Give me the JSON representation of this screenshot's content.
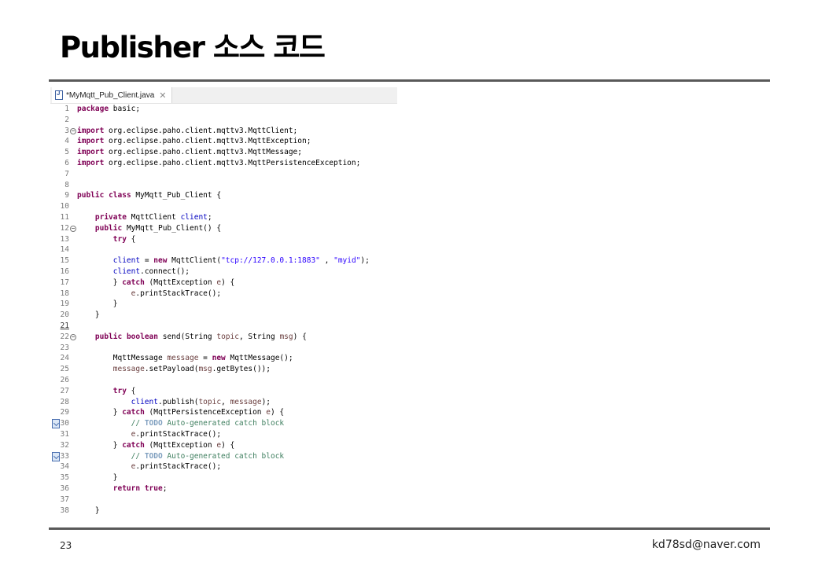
{
  "slide": {
    "title": "Publisher 소스 코드",
    "page_number": "23",
    "email": "kd78sd@naver.com"
  },
  "editor": {
    "tab": {
      "label": "*MyMqtt_Pub_Client.java",
      "icon": "java-file-icon",
      "close_glyph": "✕"
    },
    "lines": [
      {
        "num": "1",
        "tokens": [
          [
            "kw",
            "package"
          ],
          [
            "t",
            " basic;"
          ]
        ]
      },
      {
        "num": "2",
        "tokens": []
      },
      {
        "num": "3",
        "fold": true,
        "tokens": [
          [
            "kw",
            "import"
          ],
          [
            "t",
            " org.eclipse.paho.client.mqttv3.MqttClient;"
          ]
        ]
      },
      {
        "num": "4",
        "tokens": [
          [
            "kw",
            "import"
          ],
          [
            "t",
            " org.eclipse.paho.client.mqttv3.MqttException;"
          ]
        ]
      },
      {
        "num": "5",
        "tokens": [
          [
            "kw",
            "import"
          ],
          [
            "t",
            " org.eclipse.paho.client.mqttv3.MqttMessage;"
          ]
        ]
      },
      {
        "num": "6",
        "tokens": [
          [
            "kw",
            "import"
          ],
          [
            "t",
            " org.eclipse.paho.client.mqttv3.MqttPersistenceException;"
          ]
        ]
      },
      {
        "num": "7",
        "tokens": []
      },
      {
        "num": "8",
        "tokens": []
      },
      {
        "num": "9",
        "tokens": [
          [
            "kw",
            "public"
          ],
          [
            "t",
            " "
          ],
          [
            "kw",
            "class"
          ],
          [
            "t",
            " MyMqtt_Pub_Client {"
          ]
        ]
      },
      {
        "num": "10",
        "tokens": []
      },
      {
        "num": "11",
        "tokens": [
          [
            "t",
            "    "
          ],
          [
            "kw",
            "private"
          ],
          [
            "t",
            " MqttClient "
          ],
          [
            "fld",
            "client"
          ],
          [
            "t",
            ";"
          ]
        ]
      },
      {
        "num": "12",
        "fold": true,
        "tokens": [
          [
            "t",
            "    "
          ],
          [
            "kw",
            "public"
          ],
          [
            "t",
            " MyMqtt_Pub_Client() {"
          ]
        ]
      },
      {
        "num": "13",
        "tokens": [
          [
            "t",
            "        "
          ],
          [
            "kw",
            "try"
          ],
          [
            "t",
            " {"
          ]
        ]
      },
      {
        "num": "14",
        "tokens": []
      },
      {
        "num": "15",
        "tokens": [
          [
            "t",
            "        "
          ],
          [
            "fld",
            "client"
          ],
          [
            "t",
            " = "
          ],
          [
            "kw",
            "new"
          ],
          [
            "t",
            " MqttClient("
          ],
          [
            "str",
            "\"tcp://127.0.0.1:1883\""
          ],
          [
            "t",
            " , "
          ],
          [
            "str",
            "\"myid\""
          ],
          [
            "t",
            ");"
          ]
        ]
      },
      {
        "num": "16",
        "tokens": [
          [
            "t",
            "        "
          ],
          [
            "fld",
            "client"
          ],
          [
            "t",
            ".connect();"
          ]
        ]
      },
      {
        "num": "17",
        "tokens": [
          [
            "t",
            "        } "
          ],
          [
            "kw",
            "catch"
          ],
          [
            "t",
            " (MqttException "
          ],
          [
            "par",
            "e"
          ],
          [
            "t",
            ") {"
          ]
        ]
      },
      {
        "num": "18",
        "tokens": [
          [
            "t",
            "            "
          ],
          [
            "par",
            "e"
          ],
          [
            "t",
            ".printStackTrace();"
          ]
        ]
      },
      {
        "num": "19",
        "tokens": [
          [
            "t",
            "        }"
          ]
        ]
      },
      {
        "num": "20",
        "tokens": [
          [
            "t",
            "    }"
          ]
        ]
      },
      {
        "num": "21",
        "current": true,
        "tokens": []
      },
      {
        "num": "22",
        "fold": true,
        "tokens": [
          [
            "t",
            "    "
          ],
          [
            "kw",
            "public"
          ],
          [
            "t",
            " "
          ],
          [
            "kw",
            "boolean"
          ],
          [
            "t",
            " send(String "
          ],
          [
            "par",
            "topic"
          ],
          [
            "t",
            ", String "
          ],
          [
            "par",
            "msg"
          ],
          [
            "t",
            ") {"
          ]
        ]
      },
      {
        "num": "23",
        "tokens": []
      },
      {
        "num": "24",
        "tokens": [
          [
            "t",
            "        MqttMessage "
          ],
          [
            "par",
            "message"
          ],
          [
            "t",
            " = "
          ],
          [
            "kw",
            "new"
          ],
          [
            "t",
            " MqttMessage();"
          ]
        ]
      },
      {
        "num": "25",
        "tokens": [
          [
            "t",
            "        "
          ],
          [
            "par",
            "message"
          ],
          [
            "t",
            ".setPayload("
          ],
          [
            "par",
            "msg"
          ],
          [
            "t",
            ".getBytes());"
          ]
        ]
      },
      {
        "num": "26",
        "tokens": []
      },
      {
        "num": "27",
        "tokens": [
          [
            "t",
            "        "
          ],
          [
            "kw",
            "try"
          ],
          [
            "t",
            " {"
          ]
        ]
      },
      {
        "num": "28",
        "tokens": [
          [
            "t",
            "            "
          ],
          [
            "fld",
            "client"
          ],
          [
            "t",
            ".publish("
          ],
          [
            "par",
            "topic"
          ],
          [
            "t",
            ", "
          ],
          [
            "par",
            "message"
          ],
          [
            "t",
            ");"
          ]
        ]
      },
      {
        "num": "29",
        "tokens": [
          [
            "t",
            "        } "
          ],
          [
            "kw",
            "catch"
          ],
          [
            "t",
            " (MqttPersistenceException "
          ],
          [
            "par",
            "e"
          ],
          [
            "t",
            ") {"
          ]
        ]
      },
      {
        "num": "30",
        "marker": true,
        "tokens": [
          [
            "t",
            "            "
          ],
          [
            "cmt",
            "// "
          ],
          [
            "todo",
            "TODO"
          ],
          [
            "cmt",
            " Auto-generated catch block"
          ]
        ]
      },
      {
        "num": "31",
        "tokens": [
          [
            "t",
            "            "
          ],
          [
            "par",
            "e"
          ],
          [
            "t",
            ".printStackTrace();"
          ]
        ]
      },
      {
        "num": "32",
        "tokens": [
          [
            "t",
            "        } "
          ],
          [
            "kw",
            "catch"
          ],
          [
            "t",
            " (MqttException "
          ],
          [
            "par",
            "e"
          ],
          [
            "t",
            ") {"
          ]
        ]
      },
      {
        "num": "33",
        "marker": true,
        "tokens": [
          [
            "t",
            "            "
          ],
          [
            "cmt",
            "// "
          ],
          [
            "todo",
            "TODO"
          ],
          [
            "cmt",
            " Auto-generated catch block"
          ]
        ]
      },
      {
        "num": "34",
        "tokens": [
          [
            "t",
            "            "
          ],
          [
            "par",
            "e"
          ],
          [
            "t",
            ".printStackTrace();"
          ]
        ]
      },
      {
        "num": "35",
        "tokens": [
          [
            "t",
            "        }"
          ]
        ]
      },
      {
        "num": "36",
        "tokens": [
          [
            "t",
            "        "
          ],
          [
            "kw",
            "return"
          ],
          [
            "t",
            " "
          ],
          [
            "kw",
            "true"
          ],
          [
            "t",
            ";"
          ]
        ]
      },
      {
        "num": "37",
        "tokens": []
      },
      {
        "num": "38",
        "tokens": [
          [
            "t",
            "    }"
          ]
        ]
      }
    ]
  }
}
